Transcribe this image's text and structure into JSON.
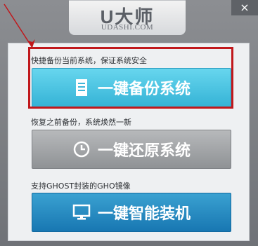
{
  "header": {
    "logo_text": "U大师",
    "site": "UDASHI.COM"
  },
  "window": {
    "close_glyph": "×"
  },
  "sections": [
    {
      "label": "快捷备份当前系统，保证系统安全",
      "button": "一键备份系统",
      "icon": "document-icon"
    },
    {
      "label": "恢复之前备份，系统焕然一新",
      "button": "一键还原系统",
      "icon": "clock-icon"
    },
    {
      "label": "支持GHOST封装的GHO镜像",
      "button": "一键智能装机",
      "icon": "monitor-icon"
    }
  ],
  "colors": {
    "highlight": "#c0181c",
    "backup": "#45c0e0",
    "restore": "#a3a5a8",
    "install": "#2a8cc2"
  }
}
